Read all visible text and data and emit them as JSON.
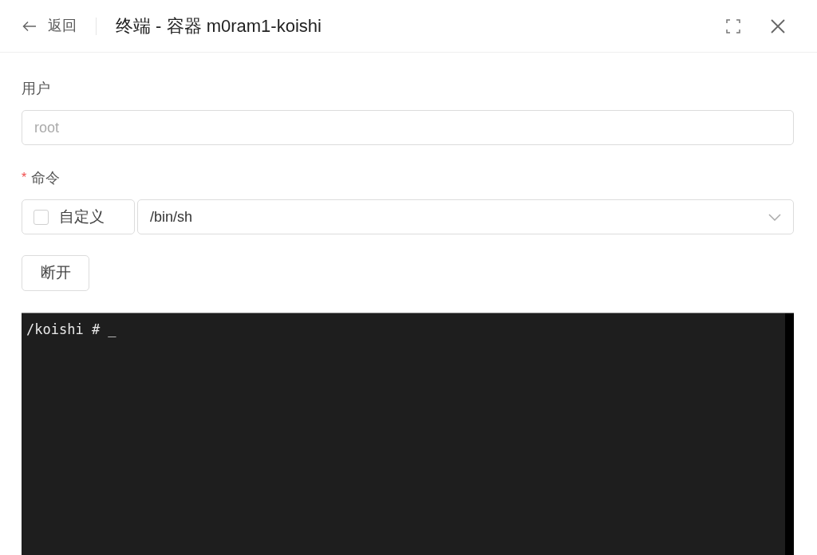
{
  "header": {
    "back_label": "返回",
    "title": "终端 - 容器 m0ram1-koishi"
  },
  "user_field": {
    "label": "用户",
    "placeholder": "root"
  },
  "command_field": {
    "label": "命令",
    "required_mark": "*",
    "custom": {
      "label": "自定义",
      "checked": false
    },
    "value": "/bin/sh"
  },
  "disconnect_button": "断开",
  "terminal": {
    "lines": [
      "/koishi # _"
    ]
  }
}
